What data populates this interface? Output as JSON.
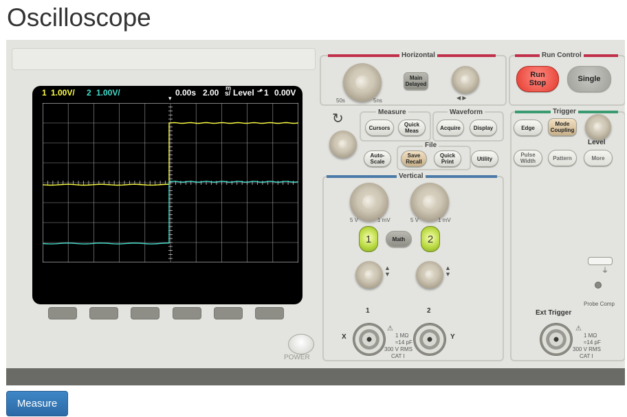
{
  "page": {
    "title": "Oscilloscope"
  },
  "screen": {
    "ch1_label": "1",
    "ch1_scale": "1.00V/",
    "ch2_label": "2",
    "ch2_scale": "1.00V/",
    "time_offset": "0.00s",
    "time_base": "2.00",
    "time_unit_top": "m",
    "time_unit_bottom": "s/",
    "trigger_text": "Level",
    "trigger_source": "1",
    "trigger_level": "0.00V",
    "ch1_marker": "1",
    "ch2_marker": "2",
    "ch1_color": "#ffff44",
    "ch2_color": "#44ddcc"
  },
  "horizontal": {
    "label": "Horizontal",
    "slow_label": "50s",
    "fast_label": "5ns",
    "main_delayed_line1": "Main",
    "main_delayed_line2": "Delayed",
    "arrows": "◀  ▶"
  },
  "run_control": {
    "label": "Run Control",
    "run_stop_line1": "Run",
    "run_stop_line2": "Stop",
    "single": "Single"
  },
  "measure_section": {
    "label": "Measure",
    "cursors": "Cursors",
    "quick_meas_line1": "Quick",
    "quick_meas_line2": "Meas"
  },
  "waveform_section": {
    "label": "Waveform",
    "acquire": "Acquire",
    "display": "Display"
  },
  "file_section": {
    "label": "File",
    "auto_scale_line1": "Auto-",
    "auto_scale_line2": "Scale",
    "save_recall_line1": "Save",
    "save_recall_line2": "Recall",
    "quick_print_line1": "Quick",
    "quick_print_line2": "Print",
    "utility": "Utility"
  },
  "trigger_section": {
    "label": "Trigger",
    "edge": "Edge",
    "mode_coupling_line1": "Mode",
    "mode_coupling_line2": "Coupling",
    "level": "Level",
    "pulse_width_line1": "Pulse",
    "pulse_width_line2": "Width",
    "pattern": "Pattern",
    "more": "More",
    "probe_comp": "Probe Comp",
    "ext_trigger": "Ext Trigger",
    "ext_spec_line1": "1 MΩ",
    "ext_spec_line2": "≈14 pF",
    "ext_spec_line3": "300 V  RMS",
    "ext_spec_line4": "CAT I"
  },
  "vertical_section": {
    "label": "Vertical",
    "ch1_5v": "5 V",
    "ch1_1mv": "1 mV",
    "ch2_5v": "5 V",
    "ch2_1mv": "1 mV",
    "ch1_button": "1",
    "math": "Math",
    "ch2_button": "2",
    "input1_number": "1",
    "input2_number": "2",
    "x_label": "X",
    "y_label": "Y",
    "spec_line1": "1 MΩ",
    "spec_line2": "≈14 pF",
    "spec_line3": "300 V  RMS",
    "spec_line4": "CAT I"
  },
  "power": {
    "label": "POWER"
  },
  "actions": {
    "measure_button": "Measure"
  }
}
